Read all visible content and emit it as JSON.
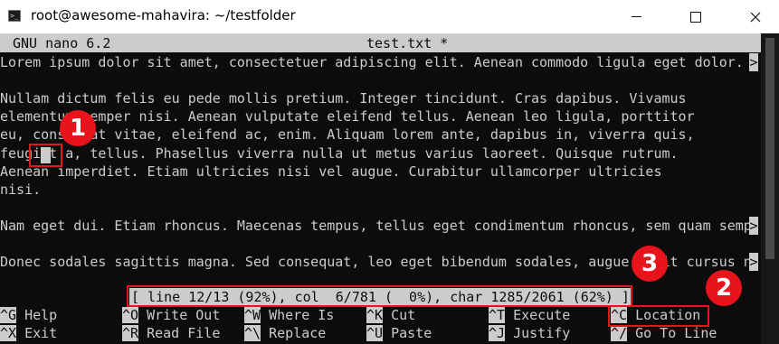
{
  "window": {
    "title": "root@awesome-mahavira: ~/testfolder",
    "app_icon_glyph": ">_",
    "controls": [
      "minimize",
      "maximize",
      "close"
    ]
  },
  "nano": {
    "version": "GNU nano 6.2",
    "filename": "test.txt *",
    "overflow_marker": ">",
    "lines": [
      "Lorem ipsum dolor sit amet, consectetuer adipiscing elit. Aenean commodo ligula eget dolor.",
      "",
      "Nullam dictum felis eu pede mollis pretium. Integer tincidunt. Cras dapibus. Vivamus",
      "elementum semper nisi. Aenean vulputate eleifend tellus. Aenean leo ligula, porttitor",
      "eu, consequat vitae, eleifend ac, enim. Aliquam lorem ante, dapibus in, viverra quis,",
      "feugiat a, tellus. Phasellus viverra nulla ut metus varius laoreet. Quisque rutrum.",
      "Aenean imperdiet. Etiam ultricies nisi vel augue. Curabitur ullamcorper ultricies",
      "nisi.",
      "",
      "Nam eget dui. Etiam rhoncus. Maecenas tempus, tellus eget condimentum rhoncus, sem quam semp",
      "",
      "Donec sodales sagittis magna. Sed consequat, leo eget bibendum sodales, augue velit cursus n"
    ],
    "status": "[ line 12/13 (92%), col  6/781 (  0%), char 1285/2061 (62%) ]",
    "shortcuts_row1": [
      {
        "key": "^G",
        "label": "Help"
      },
      {
        "key": "^O",
        "label": "Write Out"
      },
      {
        "key": "^W",
        "label": "Where Is"
      },
      {
        "key": "^K",
        "label": "Cut"
      },
      {
        "key": "^T",
        "label": "Execute"
      },
      {
        "key": "^C",
        "label": "Location"
      }
    ],
    "shortcuts_row2": [
      {
        "key": "^X",
        "label": "Exit"
      },
      {
        "key": "^R",
        "label": "Read File"
      },
      {
        "key": "^\\",
        "label": "Replace"
      },
      {
        "key": "^U",
        "label": "Paste"
      },
      {
        "key": "^J",
        "label": "Justify"
      },
      {
        "key": "^/",
        "label": "Go To Line"
      }
    ]
  },
  "annotations": {
    "badges": [
      "1",
      "2",
      "3"
    ],
    "color": "#e8141b"
  },
  "colors": {
    "terminal_bg": "#0c0c0c",
    "terminal_fg": "#cccccc",
    "accent_red": "#e8141b"
  }
}
